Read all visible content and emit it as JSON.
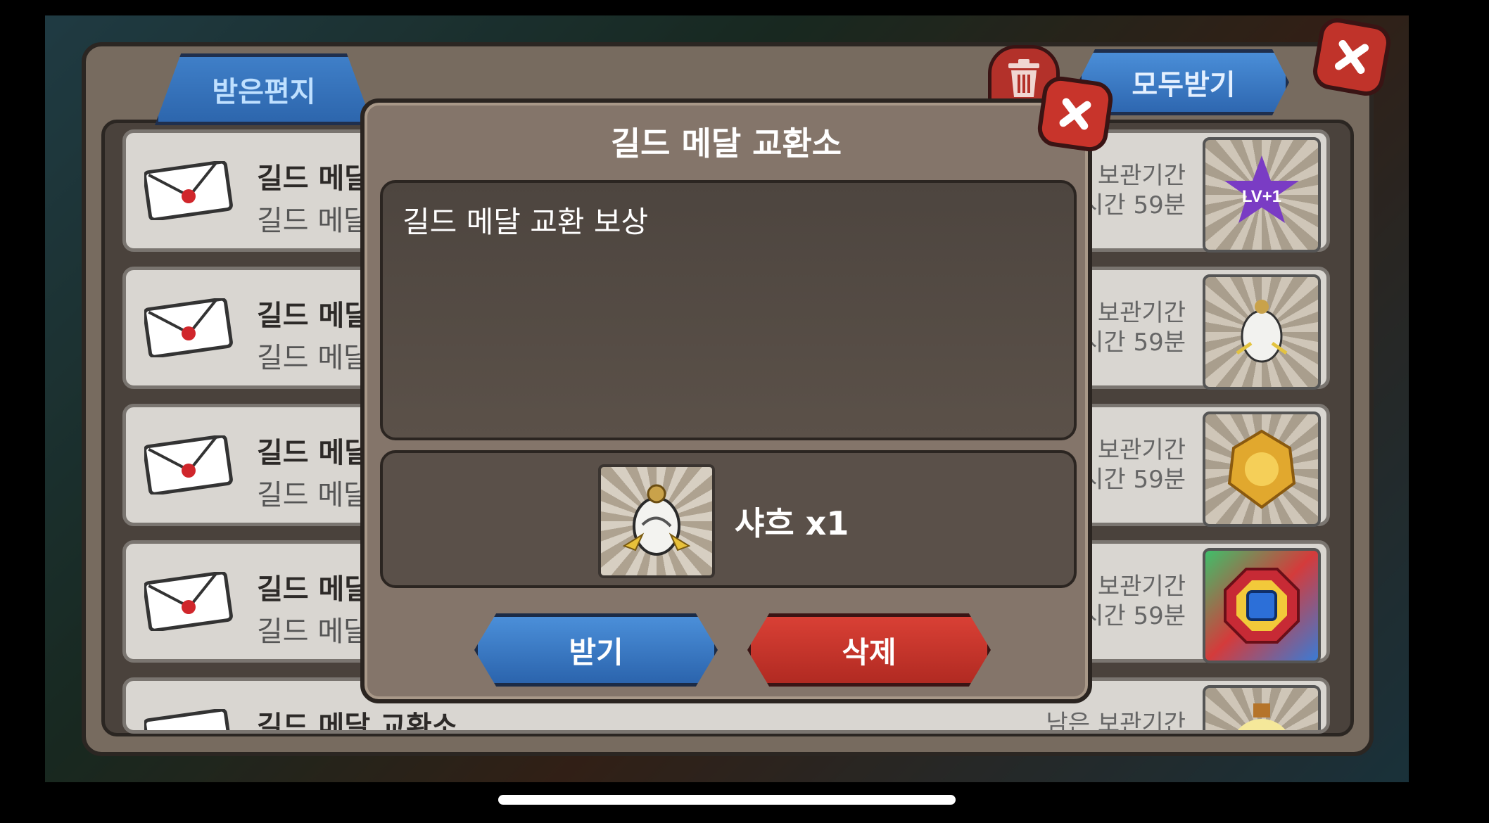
{
  "mailbox": {
    "tab_received": "받은편지",
    "claim_all": "모두받기",
    "rows": [
      {
        "title": "길드 메달",
        "sub": "길드 메달",
        "expire_line1": "보관기간",
        "expire_line2": "시간 59분",
        "reward_icon": "level-up-icon"
      },
      {
        "title": "길드 메달",
        "sub": "길드 메달",
        "expire_line1": "보관기간",
        "expire_line2": "시간 59분",
        "reward_icon": "egg-icon"
      },
      {
        "title": "길드 메달",
        "sub": "길드 메달",
        "expire_line1": "보관기간",
        "expire_line2": "시간 59분",
        "reward_icon": "gold-medal-icon"
      },
      {
        "title": "길드 메달",
        "sub": "길드 메달",
        "expire_line1": "보관기간",
        "expire_line2": "시간 59분",
        "reward_icon": "gem-icon"
      },
      {
        "title": "길드 메달 교환소",
        "sub": "",
        "expire_line1": "남은 보관기간",
        "expire_line2": "",
        "reward_icon": "potion-icon"
      }
    ]
  },
  "dialog": {
    "title": "길드 메달 교환소",
    "message": "길드 메달 교환 보상",
    "reward_label": "샤흐 x1",
    "receive_button": "받기",
    "delete_button": "삭제"
  },
  "colors": {
    "blue_button": "#2e67b0",
    "red_button": "#c0332a",
    "dialog_bg": "#84756a"
  }
}
